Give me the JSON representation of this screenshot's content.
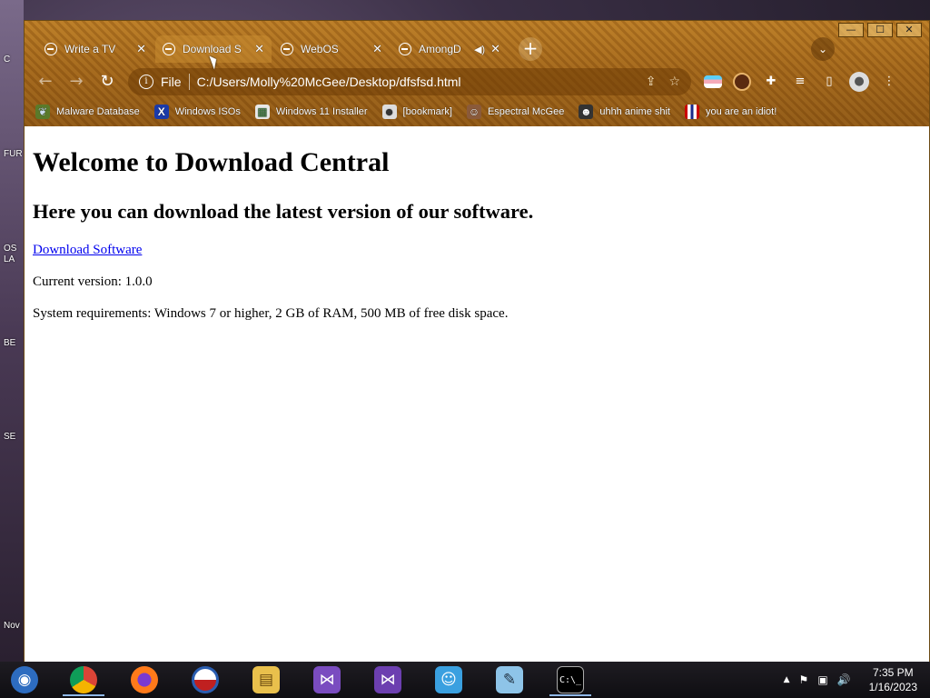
{
  "desktop": {
    "labels": [
      "C",
      "FUR",
      "OS",
      "LA",
      "BE",
      "SE",
      "Nov"
    ]
  },
  "window": {
    "controls": {
      "minimize": "—",
      "restore": "☐",
      "close": "✕"
    }
  },
  "tabs": [
    {
      "title": "Write a TV",
      "icon": "chatgpt-icon",
      "active": false
    },
    {
      "title": "Download S",
      "icon": "globe-icon",
      "active": true
    },
    {
      "title": "WebOS",
      "icon": "globe-icon",
      "active": false
    },
    {
      "title": "AmongD",
      "icon": "globe-icon",
      "active": false,
      "audio": true
    }
  ],
  "tab_close_glyph": "✕",
  "new_tab_glyph": "+",
  "tab_search_glyph": "⌄",
  "toolbar": {
    "back_glyph": "←",
    "forward_glyph": "→",
    "reload_glyph": "↻",
    "scheme": "File",
    "url": "C:/Users/Molly%20McGee/Desktop/dfsfsd.html",
    "share_glyph": "⇪",
    "star_glyph": "☆",
    "extensions_glyph": "✚",
    "media_glyph": "≡",
    "sidebar_glyph": "▯",
    "profile_glyph": "●",
    "menu_glyph": "⋮"
  },
  "bookmarks": [
    {
      "label": "Malware Database",
      "icon": "leaf-icon"
    },
    {
      "label": "Windows ISOs",
      "icon": "x-icon"
    },
    {
      "label": "Windows 11 Installer",
      "icon": "image-icon"
    },
    {
      "label": "[bookmark]",
      "icon": "anime-icon"
    },
    {
      "label": "Espectral McGee",
      "icon": "character-icon"
    },
    {
      "label": "uhhh anime shit",
      "icon": "anime-icon"
    },
    {
      "label": "you are an idiot!",
      "icon": "flag-icon"
    }
  ],
  "page": {
    "heading": "Welcome to Download Central",
    "subheading": "Here you can download the latest version of our software.",
    "download_link": "Download Software",
    "version": "Current version: 1.0.0",
    "requirements": "System requirements: Windows 7 or higher, 2 GB of RAM, 500 MB of free disk space."
  },
  "taskbar": {
    "items": [
      {
        "name": "start",
        "icon": "start-icon",
        "glyph": "◉",
        "color": "#2d6cc0",
        "running": false
      },
      {
        "name": "chrome",
        "icon": "chrome-icon",
        "glyph": "◍",
        "color": "#d8a42a",
        "running": true
      },
      {
        "name": "firefox",
        "icon": "firefox-icon",
        "glyph": "◐",
        "color": "#e05a1e",
        "running": false
      },
      {
        "name": "obama",
        "icon": "logo-icon",
        "glyph": "◒",
        "color": "#2a5db0",
        "running": false
      },
      {
        "name": "explorer",
        "icon": "folder-icon",
        "glyph": "▤",
        "color": "#e9c04c",
        "running": false
      },
      {
        "name": "vs-installer",
        "icon": "visual-studio-installer-icon",
        "glyph": "⋈",
        "color": "#7a4cc0",
        "running": false
      },
      {
        "name": "visual-studio",
        "icon": "visual-studio-icon",
        "glyph": "⋈",
        "color": "#6c3fb0",
        "running": false
      },
      {
        "name": "messenger",
        "icon": "messenger-icon",
        "glyph": "☺",
        "color": "#3aa0e0",
        "running": false
      },
      {
        "name": "notepad",
        "icon": "notepad-icon",
        "glyph": "✎",
        "color": "#8ec4e8",
        "running": false
      },
      {
        "name": "cmd",
        "icon": "terminal-icon",
        "glyph": "C:\\_",
        "color": "#000000",
        "running": true
      }
    ],
    "tray": {
      "chevron": "▲",
      "flag": "⚑",
      "network": "▣",
      "volume": "🔊",
      "time": "7:35 PM",
      "date": "1/16/2023"
    }
  },
  "colors": {
    "theme_orange": "#a0641a",
    "link": "#0000ee"
  }
}
